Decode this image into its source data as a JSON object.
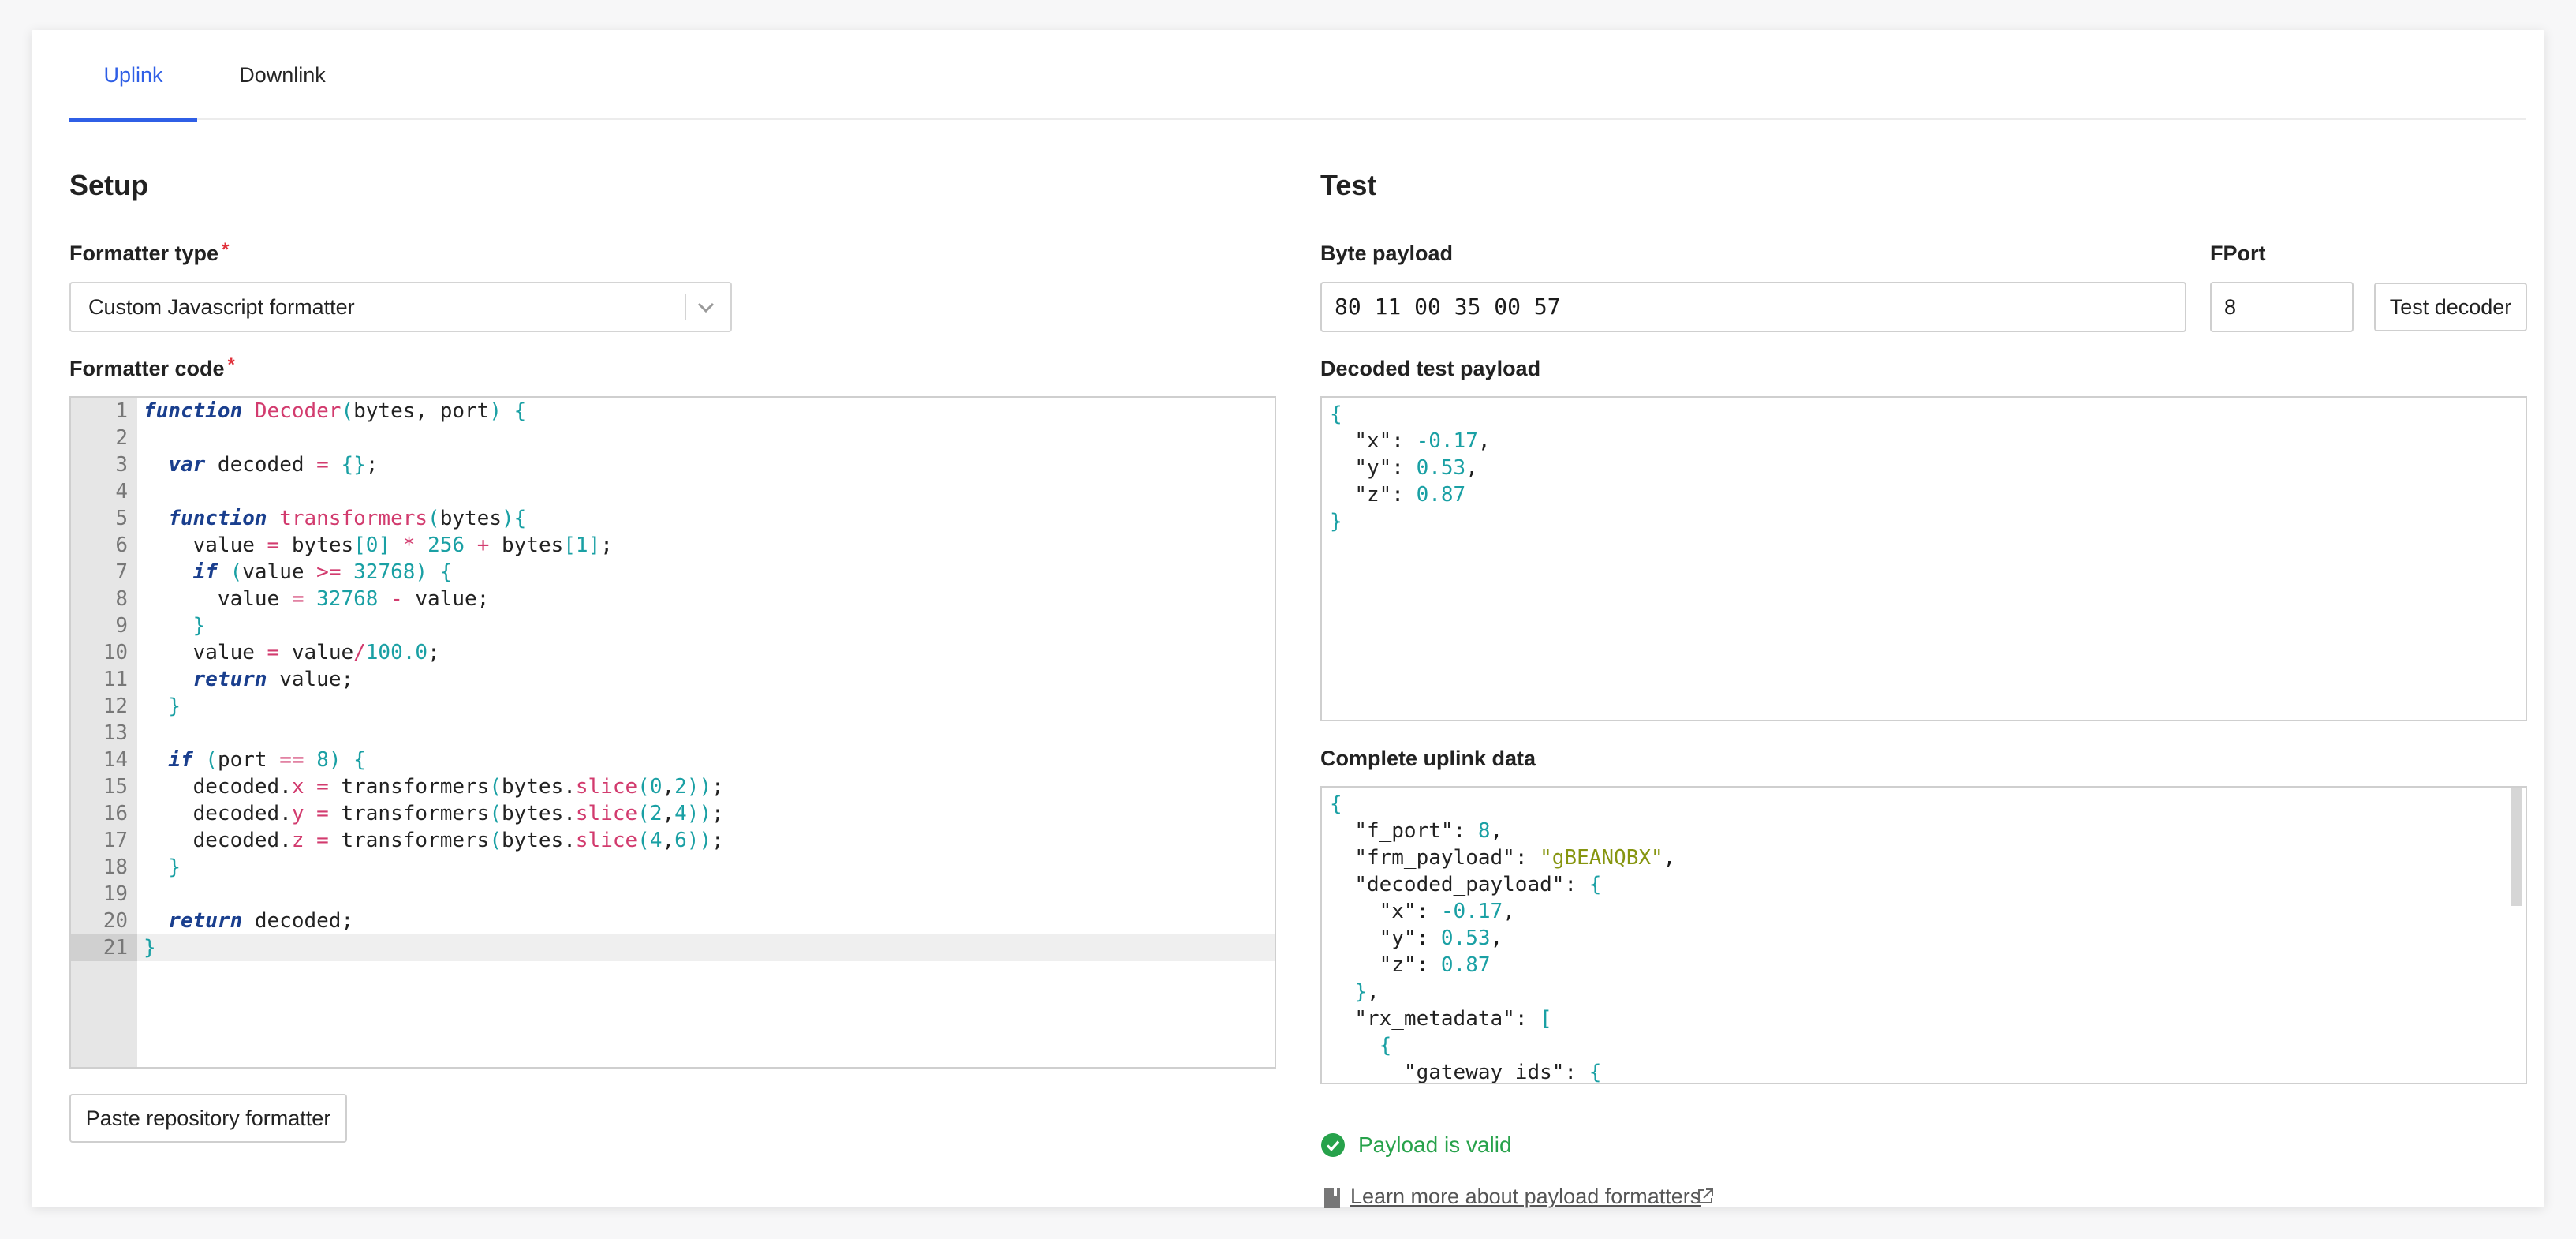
{
  "tabs": [
    {
      "label": "Uplink",
      "active": true
    },
    {
      "label": "Downlink",
      "active": false
    }
  ],
  "setup": {
    "title": "Setup",
    "formatter_type_label": "Formatter type",
    "formatter_type_value": "Custom Javascript formatter",
    "formatter_code_label": "Formatter code",
    "required_mark": "*",
    "paste_button": "Paste repository formatter",
    "code_lines": [
      "function Decoder(bytes, port) {",
      "",
      "  var decoded = {};",
      "",
      "  function transformers(bytes){",
      "    value = bytes[0] * 256 + bytes[1];",
      "    if (value >= 32768) {",
      "      value = 32768 - value;",
      "    }",
      "    value = value/100.0;",
      "    return value;",
      "  }",
      "",
      "  if (port == 8) {",
      "    decoded.x = transformers(bytes.slice(0,2));",
      "    decoded.y = transformers(bytes.slice(2,4));",
      "    decoded.z = transformers(bytes.slice(4,6));",
      "  }",
      "",
      "  return decoded;",
      "}"
    ]
  },
  "test": {
    "title": "Test",
    "byte_payload_label": "Byte payload",
    "byte_payload_value": "80 11 00 35 00 57",
    "fport_label": "FPort",
    "fport_value": "8",
    "test_button": "Test decoder",
    "decoded_label": "Decoded test payload",
    "decoded_lines": [
      "{",
      "  \"x\": -0.17,",
      "  \"y\": 0.53,",
      "  \"z\": 0.87",
      "}"
    ],
    "uplink_label": "Complete uplink data",
    "uplink_lines": [
      "{",
      "  \"f_port\": 8,",
      "  \"frm_payload\": \"gBEANQBX\",",
      "  \"decoded_payload\": {",
      "    \"x\": -0.17,",
      "    \"y\": 0.53,",
      "    \"z\": 0.87",
      "  },",
      "  \"rx_metadata\": [",
      "    {",
      "      \"gateway_ids\": {"
    ],
    "valid_text": "Payload is valid",
    "learn_link": "Learn more about payload formatters"
  },
  "colors": {
    "accent": "#2f5fe6",
    "success": "#27a24b",
    "required": "#e0303a"
  },
  "icons": {
    "select": "chevron-down-icon",
    "valid": "check-circle-icon",
    "doc": "book-icon",
    "external": "external-link-icon"
  }
}
